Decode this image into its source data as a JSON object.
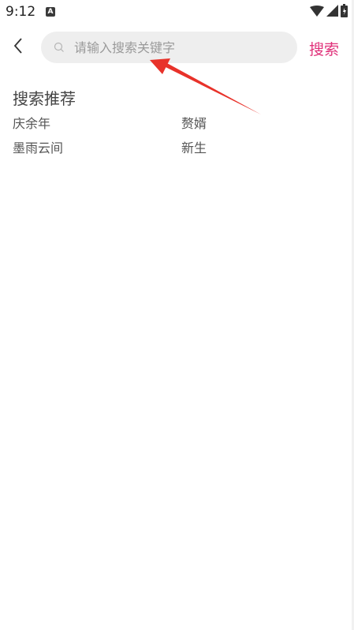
{
  "status_bar": {
    "time": "9:12",
    "notification_icon": "a-badge-icon",
    "icons": [
      "wifi-icon",
      "signal-icon",
      "battery-icon"
    ]
  },
  "header": {
    "back_icon": "chevron-left-icon",
    "search_placeholder": "请输入搜索关键字",
    "search_value": "",
    "search_button_label": "搜索"
  },
  "recommendations": {
    "title": "搜索推荐",
    "items": [
      {
        "label": "庆余年"
      },
      {
        "label": "赘婿"
      },
      {
        "label": "墨雨云间"
      },
      {
        "label": "新生"
      }
    ]
  },
  "colors": {
    "accent": "#e0317a",
    "search_bg": "#eeeeee",
    "annotation_arrow": "#e8322a"
  }
}
